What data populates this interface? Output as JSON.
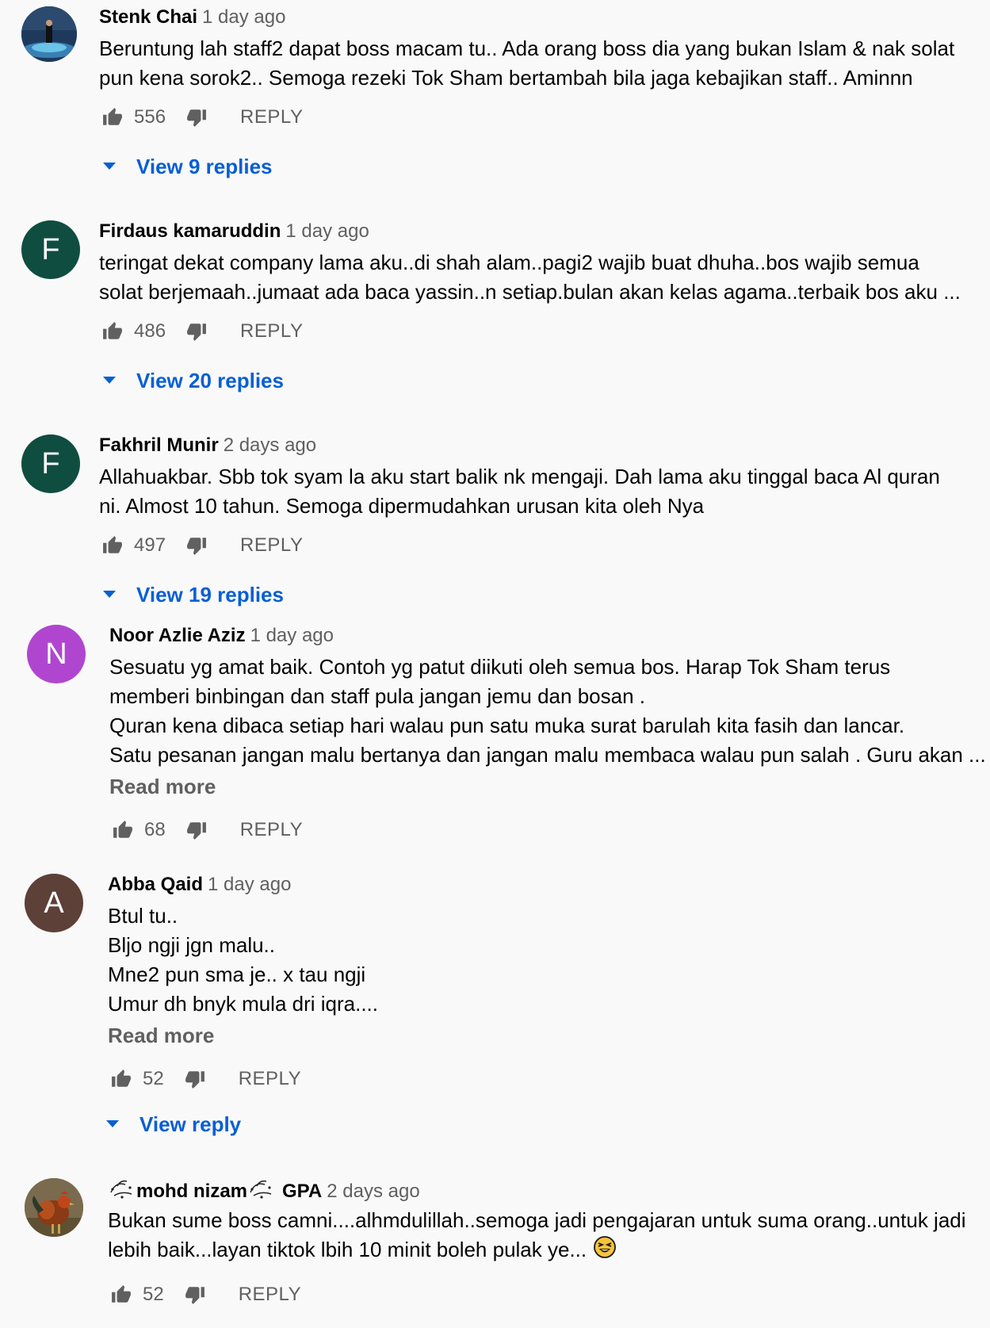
{
  "comments": [
    {
      "author": "Stenk Chai",
      "time": "1 day ago",
      "avatar_letter": "",
      "avatar_color": "#2a5c8c",
      "lines": [
        "Beruntung lah staff2 dapat boss macam tu.. Ada orang boss dia yang bukan Islam & nak solat",
        "pun kena sorok2.. Semoga rezeki Tok Sham bertambah bila jaga kebajikan staff.. Aminnn"
      ],
      "likes": "556",
      "reply_label": "REPLY",
      "view_replies": "View 9 replies"
    },
    {
      "author": "Firdaus kamaruddin",
      "time": "1 day ago",
      "avatar_letter": "F",
      "avatar_color": "#0f4d40",
      "lines": [
        "teringat dekat company lama aku..di shah alam..pagi2 wajib buat dhuha..bos wajib semua",
        "solat berjemaah..jumaat ada baca yassin..n setiap.bulan akan kelas agama..terbaik bos aku ..."
      ],
      "likes": "486",
      "reply_label": "REPLY",
      "view_replies": "View 20 replies"
    },
    {
      "author": "Fakhril Munir",
      "time": "2 days ago",
      "avatar_letter": "F",
      "avatar_color": "#0f4d40",
      "lines": [
        "Allahuakbar. Sbb tok syam la aku start balik nk mengaji. Dah lama aku tinggal baca Al quran",
        "ni. Almost 10 tahun. Semoga dipermudahkan urusan kita oleh Nya"
      ],
      "likes": "497",
      "reply_label": "REPLY",
      "view_replies": "View 19 replies"
    },
    {
      "author": "Noor Azlie Aziz",
      "time": "1 day ago",
      "avatar_letter": "N",
      "avatar_color": "#b046d0",
      "lines": [
        "Sesuatu yg amat baik. Contoh yg patut diikuti oleh semua bos. Harap Tok Sham terus",
        "memberi binbingan dan staff pula jangan jemu dan bosan .",
        "Quran kena dibaca setiap hari walau pun satu muka surat barulah kita fasih dan lancar.",
        "Satu pesanan jangan malu bertanya dan jangan malu membaca walau pun salah . Guru akan ..."
      ],
      "read_more": "Read more",
      "likes": "68",
      "reply_label": "REPLY"
    },
    {
      "author": "Abba Qaid",
      "time": "1 day ago",
      "avatar_letter": "A",
      "avatar_color": "#5d4037",
      "lines": [
        "Btul tu..",
        "Bljo ngji jgn malu..",
        "Mne2 pun sma je.. x tau ngji",
        "Umur dh bnyk mula dri iqra...."
      ],
      "read_more": "Read more",
      "likes": "52",
      "reply_label": "REPLY",
      "view_replies": "View reply"
    },
    {
      "author": "mohd nizam",
      "author_suffix": "GPA",
      "time": "2 days ago",
      "avatar_letter": "",
      "avatar_color": "#6b4a2a",
      "lines": [
        "Bukan sume boss camni....alhmdulillah..semoga jadi pengajaran untuk suma orang..untuk jadi",
        "lebih baik...layan tiktok lbih 10 minit boleh pulak ye..."
      ],
      "emoji": "grinning-squinting-face",
      "likes": "52",
      "reply_label": "REPLY"
    }
  ]
}
